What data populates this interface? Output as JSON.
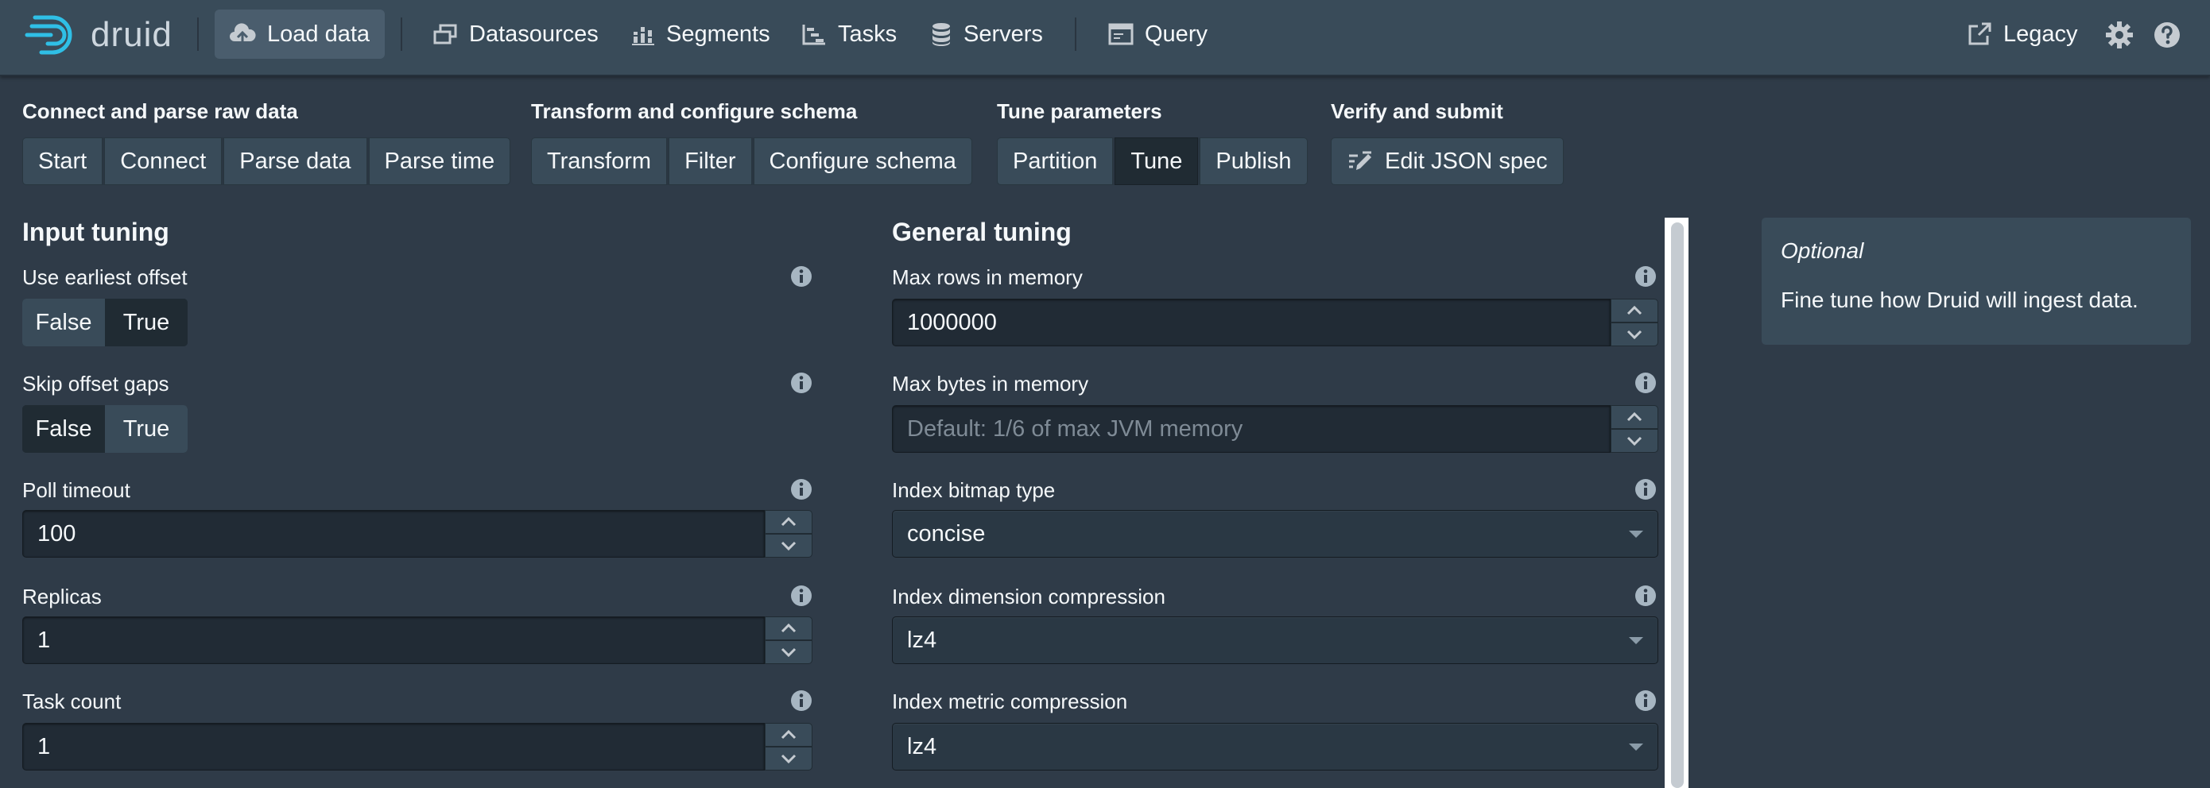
{
  "nav": {
    "logo_text": "druid",
    "load_data": "Load data",
    "datasources": "Datasources",
    "segments": "Segments",
    "tasks": "Tasks",
    "servers": "Servers",
    "query": "Query",
    "legacy": "Legacy"
  },
  "steps": {
    "connect_group": {
      "title": "Connect and parse raw data",
      "buttons": [
        "Start",
        "Connect",
        "Parse data",
        "Parse time"
      ]
    },
    "transform_group": {
      "title": "Transform and configure schema",
      "buttons": [
        "Transform",
        "Filter",
        "Configure schema"
      ]
    },
    "tune_group": {
      "title": "Tune parameters",
      "buttons": [
        "Partition",
        "Tune",
        "Publish"
      ],
      "active": "Tune"
    },
    "verify_group": {
      "title": "Verify and submit",
      "buttons": [
        "Edit JSON spec"
      ]
    }
  },
  "input_tuning": {
    "title": "Input tuning",
    "use_earliest_offset": {
      "label": "Use earliest offset",
      "options": [
        "False",
        "True"
      ],
      "selected": "False"
    },
    "skip_offset_gaps": {
      "label": "Skip offset gaps",
      "options": [
        "False",
        "True"
      ],
      "selected": "True"
    },
    "poll_timeout": {
      "label": "Poll timeout",
      "value": "100"
    },
    "replicas": {
      "label": "Replicas",
      "value": "1"
    },
    "task_count": {
      "label": "Task count",
      "value": "1"
    }
  },
  "general_tuning": {
    "title": "General tuning",
    "max_rows_in_memory": {
      "label": "Max rows in memory",
      "value": "1000000"
    },
    "max_bytes_in_memory": {
      "label": "Max bytes in memory",
      "placeholder": "Default: 1/6 of max JVM memory"
    },
    "index_bitmap_type": {
      "label": "Index bitmap type",
      "value": "concise"
    },
    "index_dimension_compression": {
      "label": "Index dimension compression",
      "value": "lz4"
    },
    "index_metric_compression": {
      "label": "Index metric compression",
      "value": "lz4"
    }
  },
  "callout": {
    "title": "Optional",
    "body": "Fine tune how Druid will ingest data."
  },
  "colors": {
    "background": "#2f3b48",
    "navbar": "#394b59",
    "active_button": "#202b33",
    "input_bg": "#212b35"
  }
}
